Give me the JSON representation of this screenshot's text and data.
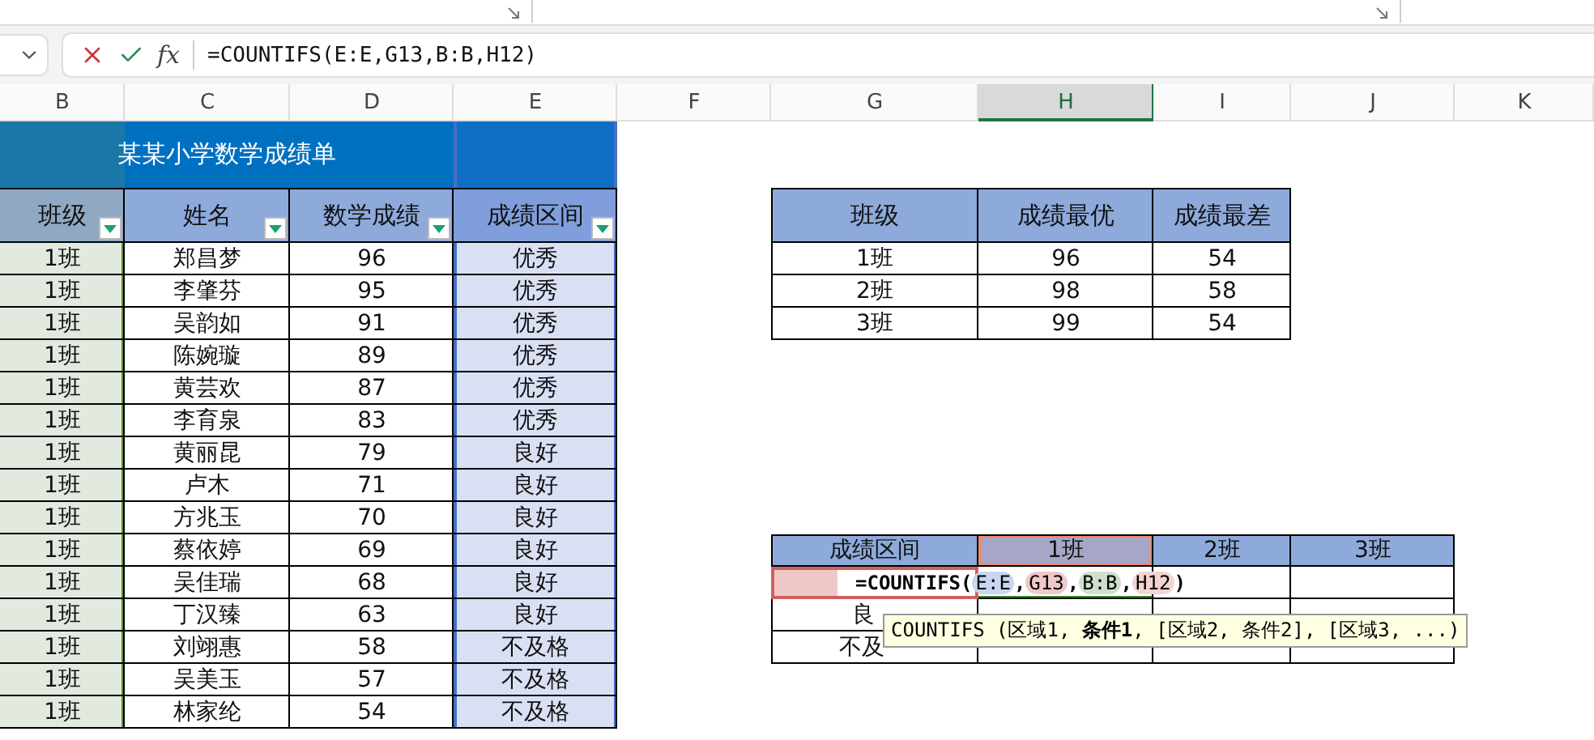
{
  "formula_bar": {
    "fx_label": "fx",
    "formula": "=COUNTIFS(E:E,G13,B:B,H12)"
  },
  "columns": [
    {
      "label": "B",
      "selected": false
    },
    {
      "label": "C",
      "selected": false
    },
    {
      "label": "D",
      "selected": false
    },
    {
      "label": "E",
      "selected": false
    },
    {
      "label": "F",
      "selected": false
    },
    {
      "label": "G",
      "selected": false
    },
    {
      "label": "H",
      "selected": true
    },
    {
      "label": "I",
      "selected": false
    },
    {
      "label": "J",
      "selected": false
    },
    {
      "label": "K",
      "selected": false
    }
  ],
  "grade_sheet": {
    "title": "某某小学数学成绩单",
    "headers": [
      "班级",
      "姓名",
      "数学成绩",
      "成绩区间"
    ],
    "rows": [
      {
        "class": "1班",
        "name": "郑昌梦",
        "score": "96",
        "band": "优秀"
      },
      {
        "class": "1班",
        "name": "李肇芬",
        "score": "95",
        "band": "优秀"
      },
      {
        "class": "1班",
        "name": "吴韵如",
        "score": "91",
        "band": "优秀"
      },
      {
        "class": "1班",
        "name": "陈婉璇",
        "score": "89",
        "band": "优秀"
      },
      {
        "class": "1班",
        "name": "黄芸欢",
        "score": "87",
        "band": "优秀"
      },
      {
        "class": "1班",
        "name": "李育泉",
        "score": "83",
        "band": "优秀"
      },
      {
        "class": "1班",
        "name": "黄丽昆",
        "score": "79",
        "band": "良好"
      },
      {
        "class": "1班",
        "name": "卢木",
        "score": "71",
        "band": "良好"
      },
      {
        "class": "1班",
        "name": "方兆玉",
        "score": "70",
        "band": "良好"
      },
      {
        "class": "1班",
        "name": "蔡依婷",
        "score": "69",
        "band": "良好"
      },
      {
        "class": "1班",
        "name": "吴佳瑞",
        "score": "68",
        "band": "良好"
      },
      {
        "class": "1班",
        "name": "丁汉臻",
        "score": "63",
        "band": "良好"
      },
      {
        "class": "1班",
        "name": "刘翊惠",
        "score": "58",
        "band": "不及格"
      },
      {
        "class": "1班",
        "name": "吴美玉",
        "score": "57",
        "band": "不及格"
      },
      {
        "class": "1班",
        "name": "林家纶",
        "score": "54",
        "band": "不及格"
      }
    ]
  },
  "summary_table": {
    "headers": [
      "班级",
      "成绩最优",
      "成绩最差"
    ],
    "rows": [
      [
        "1班",
        "96",
        "54"
      ],
      [
        "2班",
        "98",
        "58"
      ],
      [
        "3班",
        "99",
        "54"
      ]
    ]
  },
  "count_table": {
    "headers": [
      {
        "label": "成绩区间",
        "selected": false
      },
      {
        "label": "1班",
        "selected": true
      },
      {
        "label": "2班",
        "selected": false
      },
      {
        "label": "3班",
        "selected": false
      }
    ],
    "editing": {
      "prefix": "=COUNTIFS(",
      "separator": ",",
      "suffix": ")",
      "args": [
        {
          "text": "E:E",
          "color": "#c9d6ee"
        },
        {
          "text": "G13",
          "color": "#efc9c9"
        },
        {
          "text": "B:B",
          "color": "#cfdfcc"
        },
        {
          "text": "H12",
          "color": "#f4d3d3"
        }
      ]
    },
    "rows": [
      {
        "label": "良"
      },
      {
        "label": "不及"
      }
    ]
  },
  "tooltip": "COUNTIFS (区域1, **条件1**, [区域2, 条件2], [区域3, ...)"
}
